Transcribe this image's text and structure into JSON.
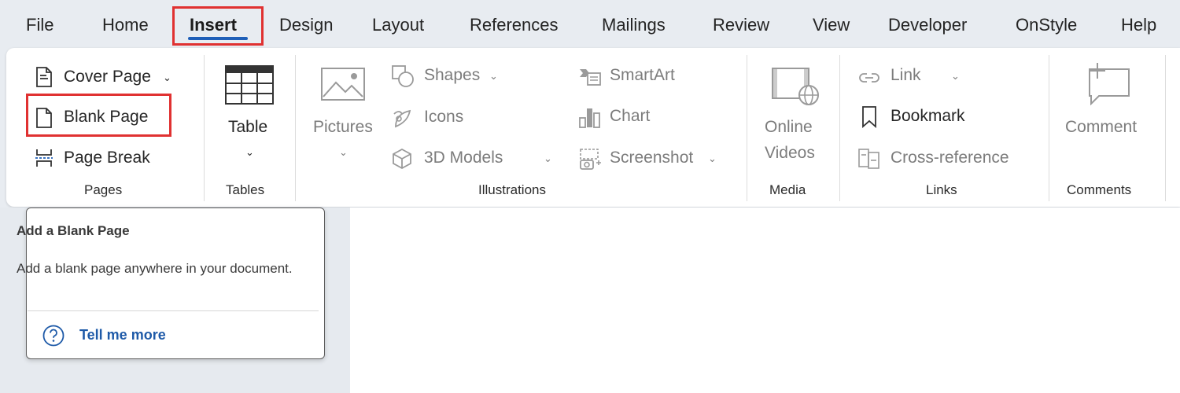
{
  "tabs": [
    {
      "label": "File"
    },
    {
      "label": "Home"
    },
    {
      "label": "Insert"
    },
    {
      "label": "Design"
    },
    {
      "label": "Layout"
    },
    {
      "label": "References"
    },
    {
      "label": "Mailings"
    },
    {
      "label": "Review"
    },
    {
      "label": "View"
    },
    {
      "label": "Developer"
    },
    {
      "label": "OnStyle"
    },
    {
      "label": "Help"
    }
  ],
  "active_tab": "Insert",
  "pages": {
    "cover_page": "Cover Page",
    "blank_page": "Blank Page",
    "page_break": "Page Break",
    "group": "Pages"
  },
  "tables": {
    "table": "Table",
    "group": "Tables"
  },
  "illustrations": {
    "pictures": "Pictures",
    "shapes": "Shapes",
    "icons": "Icons",
    "models": "3D Models",
    "smartart": "SmartArt",
    "chart": "Chart",
    "screenshot": "Screenshot",
    "group": "Illustrations"
  },
  "media": {
    "online": "Online",
    "videos": "Videos",
    "group": "Media"
  },
  "links": {
    "link": "Link",
    "bookmark": "Bookmark",
    "crossref": "Cross-reference",
    "group": "Links"
  },
  "comments": {
    "comment": "Comment",
    "group": "Comments"
  },
  "tooltip": {
    "title": "Add a Blank Page",
    "body": "Add a blank page anywhere in your document.",
    "link": "Tell me more"
  },
  "colors": {
    "accent": "#1f5fb8",
    "highlight": "#e03131",
    "link": "#1e5aa8"
  },
  "chevron": "⌄"
}
